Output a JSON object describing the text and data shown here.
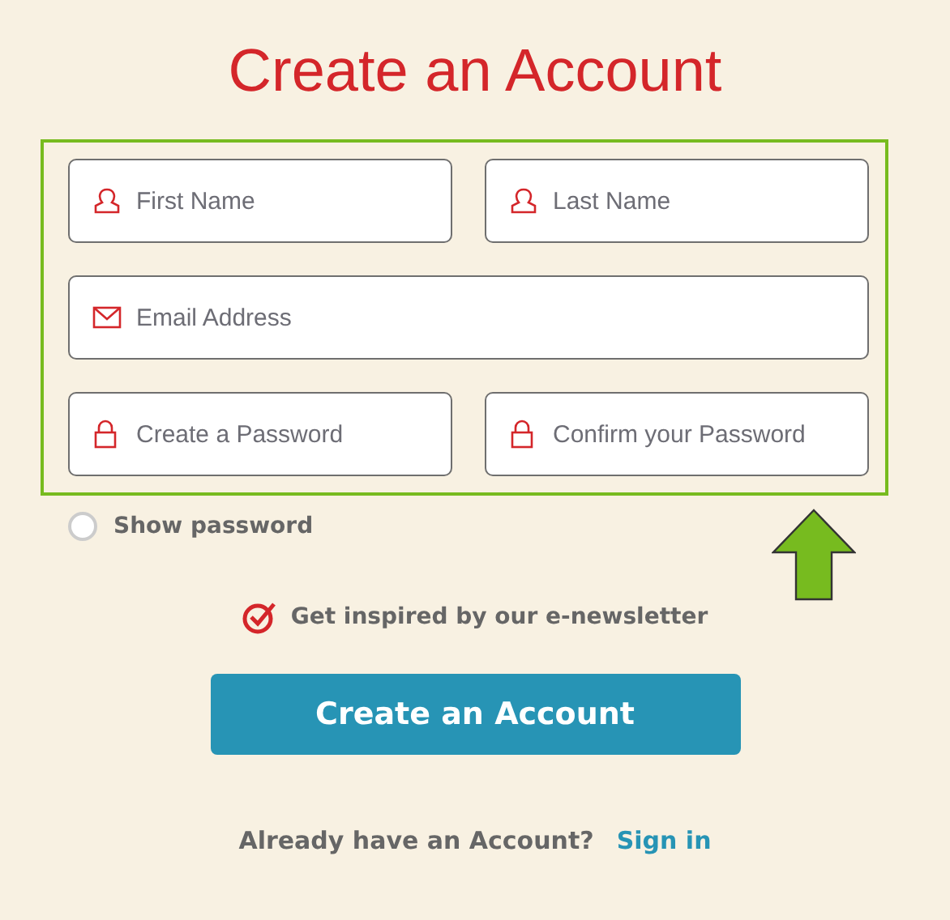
{
  "title": "Create an Account",
  "fields": [
    {
      "placeholder": "First Name",
      "kind": "person",
      "half": true
    },
    {
      "placeholder": "Last Name",
      "kind": "person",
      "half": true
    },
    {
      "placeholder": "Email Address",
      "kind": "mail",
      "half": false
    },
    {
      "placeholder": "Create a Password",
      "kind": "lock",
      "half": true
    },
    {
      "placeholder": "Confirm your Password",
      "kind": "lock",
      "half": true
    }
  ],
  "show_password": {
    "label": "Show password",
    "checked": false
  },
  "newsletter": {
    "label": "Get inspired by our e-newsletter",
    "checked": true
  },
  "submit": "Create an Account",
  "signin": {
    "prompt": "Already have an Account?",
    "link": "Sign in"
  }
}
